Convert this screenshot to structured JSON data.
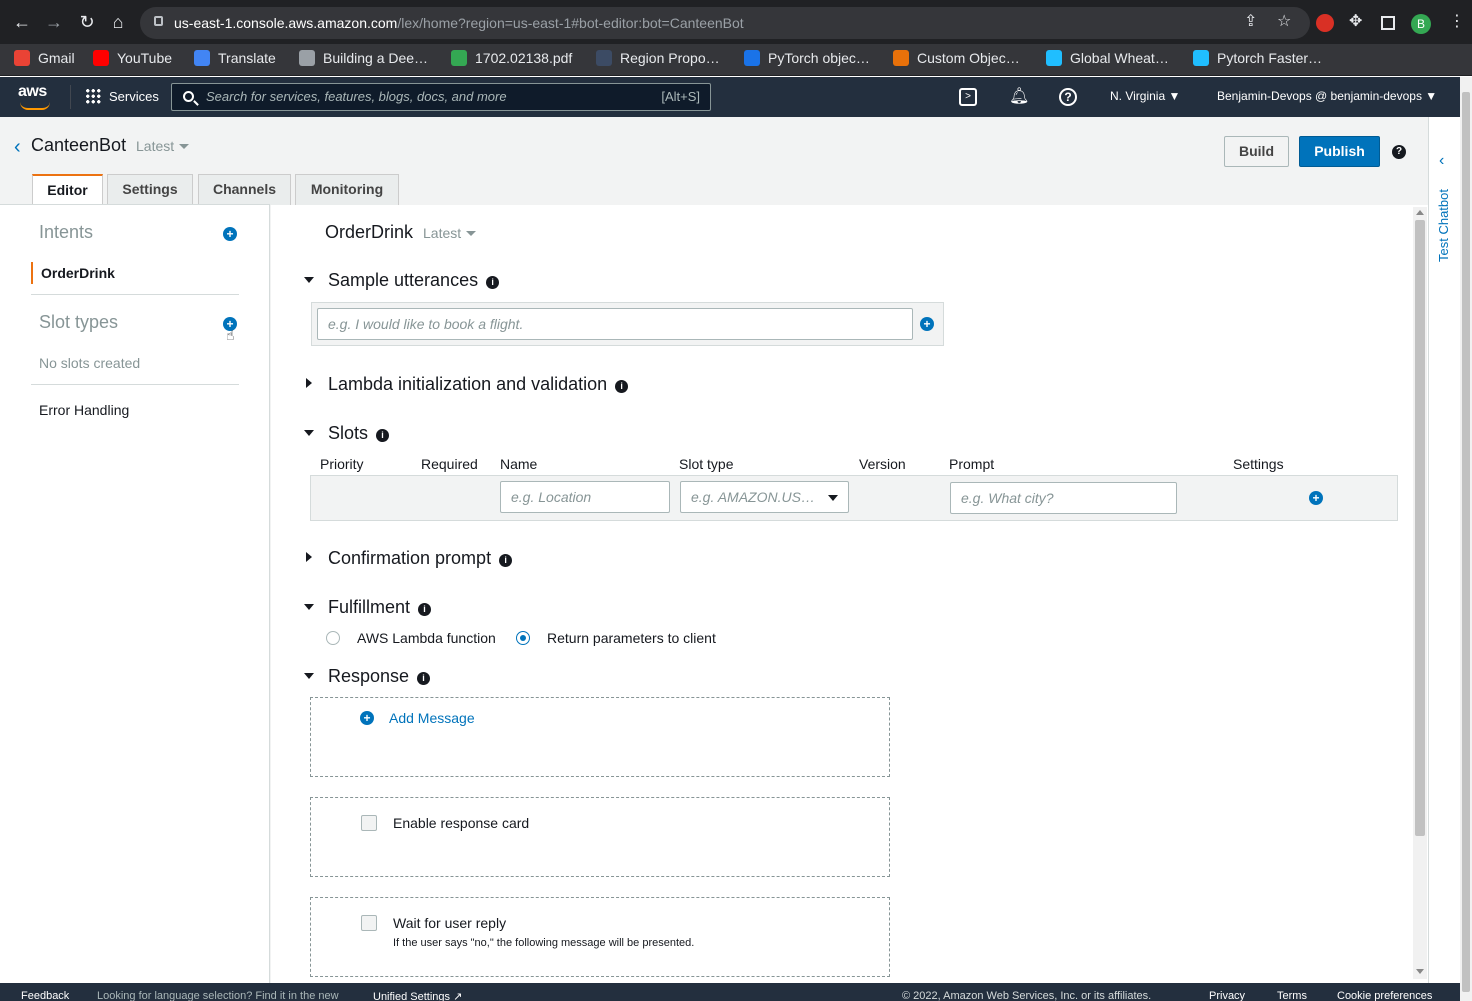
{
  "browser": {
    "url_host": "us-east-1.console.aws.amazon.com",
    "url_path": "/lex/home?region=us-east-1#bot-editor:bot=CanteenBot",
    "profile_initial": "B",
    "bookmarks": [
      {
        "label": "Gmail",
        "color": "#ea4335"
      },
      {
        "label": "YouTube",
        "color": "#ff0000"
      },
      {
        "label": "Translate",
        "color": "#4285f4"
      },
      {
        "label": "Building a Dee…",
        "color": "#9aa0a6"
      },
      {
        "label": "1702.02138.pdf",
        "color": "#34a853"
      },
      {
        "label": "Region Propo…",
        "color": "#3c4b64"
      },
      {
        "label": "PyTorch objec…",
        "color": "#1a73e8"
      },
      {
        "label": "Custom Objec…",
        "color": "#e8710a"
      },
      {
        "label": "Global Wheat…",
        "color": "#20beff"
      },
      {
        "label": "Pytorch Faster…",
        "color": "#20beff"
      }
    ]
  },
  "header": {
    "logo": "aws",
    "services_label": "Services",
    "search_placeholder": "Search for services, features, blogs, docs, and more",
    "search_shortcut": "[Alt+S]",
    "region": "N. Virginia",
    "account": "Benjamin-Devops @ benjamin-devops"
  },
  "bot": {
    "name": "CanteenBot",
    "version": "Latest",
    "build_label": "Build",
    "publish_label": "Publish",
    "tabs": [
      "Editor",
      "Settings",
      "Channels",
      "Monitoring"
    ]
  },
  "sidebar": {
    "intents_title": "Intents",
    "intent_items": [
      "OrderDrink"
    ],
    "slot_types_title": "Slot types",
    "no_slots": "No slots created",
    "error_handling": "Error Handling"
  },
  "editor": {
    "intent_name": "OrderDrink",
    "intent_version": "Latest",
    "sections": {
      "sample_utterances": "Sample utterances",
      "lambda_init": "Lambda initialization and validation",
      "slots": "Slots",
      "confirmation_prompt": "Confirmation prompt",
      "fulfillment": "Fulfillment",
      "response": "Response"
    },
    "utterance_placeholder": "e.g. I would like to book a flight.",
    "slot_columns": [
      "Priority",
      "Required",
      "Name",
      "Slot type",
      "Version",
      "Prompt",
      "Settings"
    ],
    "slot_name_placeholder": "e.g. Location",
    "slot_type_placeholder": "e.g. AMAZON.US…",
    "slot_prompt_placeholder": "e.g. What city?",
    "fulfillment_options": [
      "AWS Lambda function",
      "Return parameters to client"
    ],
    "fulfillment_selected": "Return parameters to client",
    "add_message": "Add Message",
    "enable_response_card": "Enable response card",
    "wait_for_user_reply": "Wait for user reply",
    "wait_note": "If the user says \"no,\" the following message will be presented."
  },
  "rail": {
    "test_chatbot": "Test Chatbot"
  },
  "footer": {
    "feedback": "Feedback",
    "language_note": "Looking for language selection? Find it in the new",
    "unified_settings": "Unified Settings",
    "copyright": "© 2022, Amazon Web Services, Inc. or its affiliates.",
    "privacy": "Privacy",
    "terms": "Terms",
    "cookie": "Cookie preferences"
  },
  "colors": {
    "accent": "#0073bb",
    "tab_active": "#ec7211",
    "aws_header": "#232f3e"
  }
}
